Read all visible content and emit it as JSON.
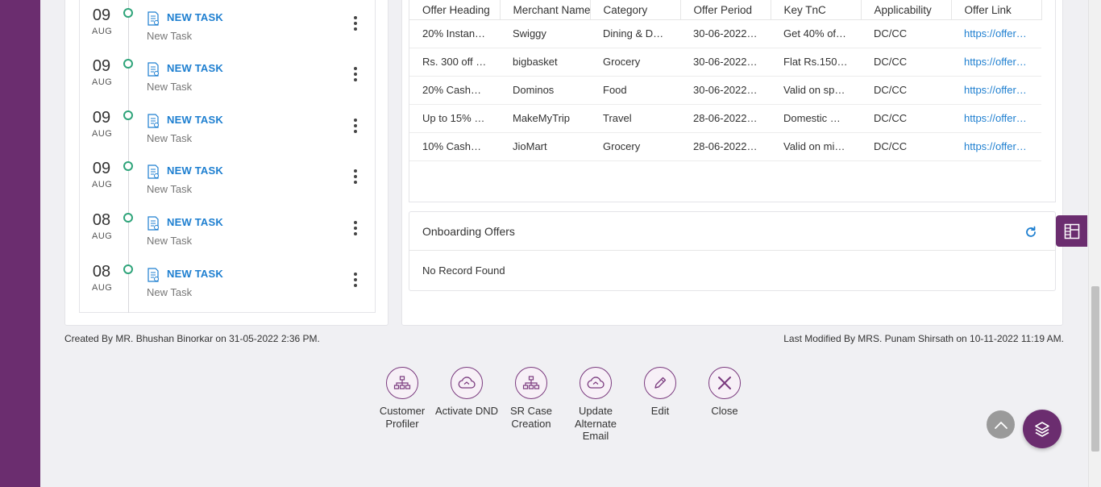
{
  "tasks": [
    {
      "day": "09",
      "month": "AUG",
      "title": "NEW TASK",
      "subtitle": "New Task"
    },
    {
      "day": "09",
      "month": "AUG",
      "title": "NEW TASK",
      "subtitle": "New Task"
    },
    {
      "day": "09",
      "month": "AUG",
      "title": "NEW TASK",
      "subtitle": "New Task"
    },
    {
      "day": "09",
      "month": "AUG",
      "title": "NEW TASK",
      "subtitle": "New Task"
    },
    {
      "day": "08",
      "month": "AUG",
      "title": "NEW TASK",
      "subtitle": "New Task"
    },
    {
      "day": "08",
      "month": "AUG",
      "title": "NEW TASK",
      "subtitle": "New Task"
    }
  ],
  "offers": {
    "columns": [
      "Offer Heading",
      "Merchant Name",
      "Category",
      "Offer Period",
      "Key TnC",
      "Applicability",
      "Offer Link"
    ],
    "rows": [
      [
        "20% Instant ...",
        "Swiggy",
        "Dining & Deli...",
        "30-06-2022 1...",
        "Get 40% off ...",
        "DC/CC",
        "https://offers..."
      ],
      [
        "Rs. 300 off o...",
        "bigbasket",
        "Grocery",
        "30-06-2022 1...",
        "Flat Rs.150 o...",
        "DC/CC",
        "https://offers..."
      ],
      [
        "20% Cashback",
        "Dominos",
        "Food",
        "30-06-2022 1...",
        "Valid on spe...",
        "DC/CC",
        "https://offers..."
      ],
      [
        "Up to 15% Of...",
        "MakeMyTrip",
        "Travel",
        "28-06-2022 1...",
        "Domestic Ho...",
        "DC/CC",
        "https://offers..."
      ],
      [
        "10% Cashback",
        "JioMart",
        "Grocery",
        "28-06-2022 1...",
        "Valid on mini...",
        "DC/CC",
        "https://offers..."
      ]
    ]
  },
  "onboarding": {
    "title": "Onboarding Offers",
    "empty": "No Record Found"
  },
  "footer": {
    "created": "Created By MR. Bhushan Binorkar on 31-05-2022 2:36 PM.",
    "modified": "Last Modified By MRS. Punam Shirsath on 10-11-2022 11:19 AM."
  },
  "actions": {
    "customer_profiler": "Customer Profiler",
    "activate_dnd": "Activate DND",
    "sr_case_creation": "SR Case Creation",
    "update_alternate_email": "Update Alternate Email",
    "edit": "Edit",
    "close": "Close"
  },
  "colors": {
    "brand": "#6b2d6f",
    "link": "#1e7fd0",
    "timeline_dot": "#2fa47a"
  },
  "icons": [
    "task-icon",
    "kebab-menu-icon",
    "refresh-icon",
    "layout-icon",
    "org-chart-icon",
    "cloud-icon",
    "pencil-icon",
    "close-icon",
    "chevron-up-icon",
    "layers-icon"
  ]
}
